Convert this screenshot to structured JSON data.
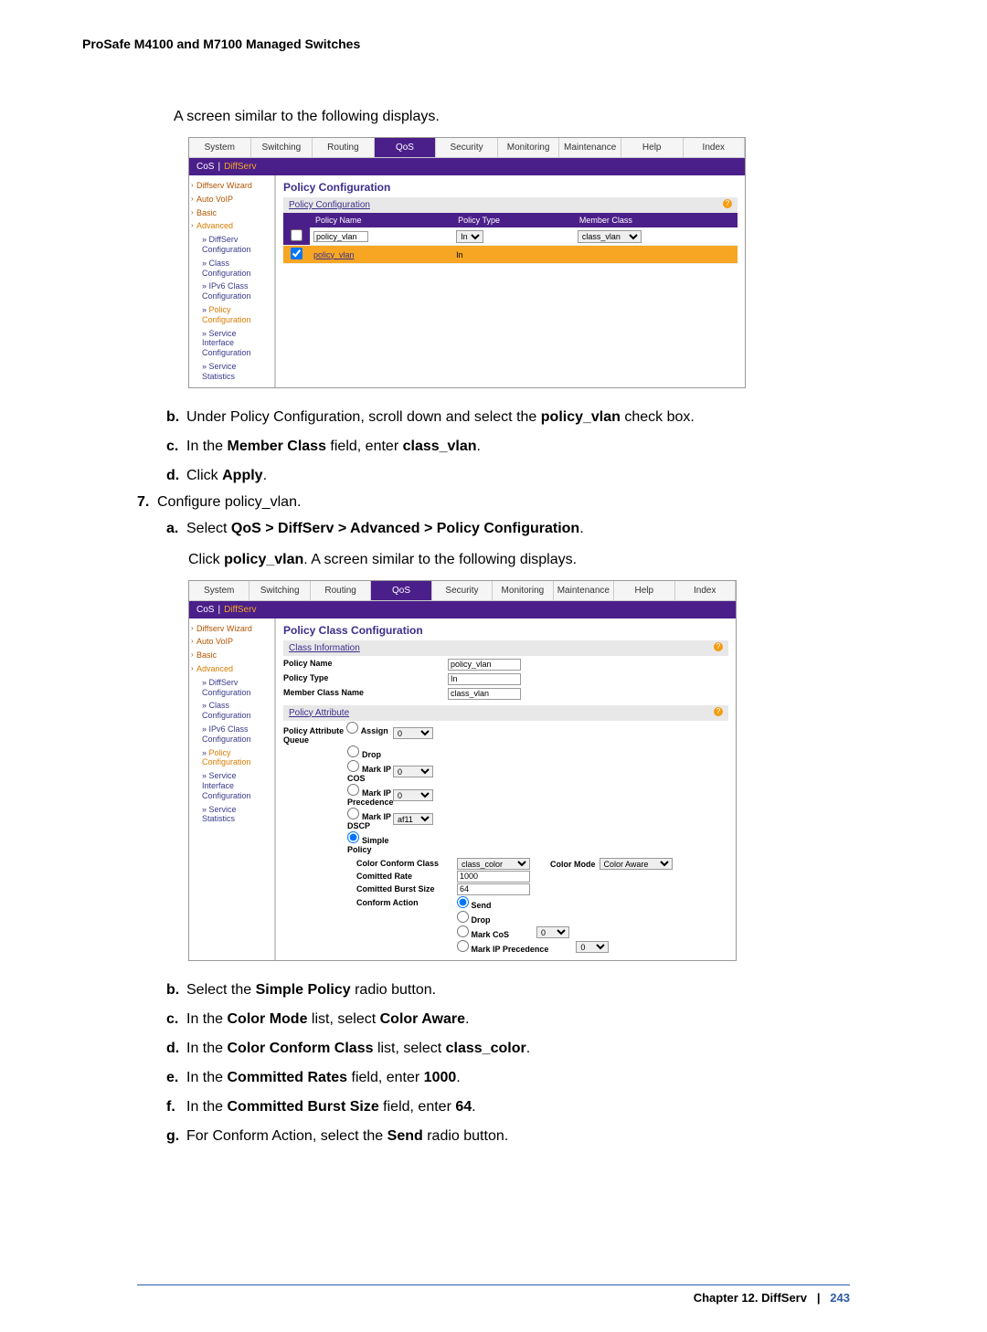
{
  "header": {
    "title": "ProSafe M4100 and M7100 Managed Switches"
  },
  "intro1": "A screen similar to the following displays.",
  "shot1": {
    "tabs": [
      "System",
      "Switching",
      "Routing",
      "QoS",
      "Security",
      "Monitoring",
      "Maintenance",
      "Help",
      "Index"
    ],
    "active_tab": "QoS",
    "subnav": [
      "CoS",
      "|",
      "DiffServ"
    ],
    "subnav_sel": "DiffServ",
    "sidebar": [
      {
        "t": "Diffserv Wizard"
      },
      {
        "t": "Auto VoIP"
      },
      {
        "t": "Basic"
      },
      {
        "t": "Advanced",
        "sel": true
      },
      {
        "t": "DiffServ Configuration",
        "sub": true
      },
      {
        "t": "Class Configuration",
        "sub": true
      },
      {
        "t": "IPv6 Class Configuration",
        "sub": true
      },
      {
        "t": "Policy Configuration",
        "sub": true,
        "sel": true
      },
      {
        "t": "Service Interface Configuration",
        "sub": true
      },
      {
        "t": "Service Statistics",
        "sub": true
      }
    ],
    "pane_title": "Policy Configuration",
    "section_label": "Policy Configuration",
    "cols": [
      "",
      "Policy Name",
      "Policy Type",
      "Member Class"
    ],
    "row_edit": {
      "cb": false,
      "name": "policy_vlan",
      "type": "In",
      "member": "class_vlan"
    },
    "row_sel": {
      "cb": true,
      "name": "policy_vlan",
      "type_text": "In"
    }
  },
  "steps1": [
    {
      "l": "b.",
      "t_pre": "Under Policy Configuration, scroll down and select the ",
      "bold": "policy_vlan",
      "t_post": " check box."
    },
    {
      "l": "c.",
      "t_pre": "In the ",
      "bold": "Member Class",
      "t_mid": " field, enter ",
      "bold2": "class_vlan",
      "t_post": "."
    },
    {
      "l": "d.",
      "t_pre": "Click ",
      "bold": "Apply",
      "t_post": "."
    }
  ],
  "step7": {
    "num": "7.",
    "text": "Configure policy_vlan."
  },
  "steps2a": {
    "l": "a.",
    "t_pre": "Select ",
    "bold": "QoS > DiffServ > Advanced > Policy Configuration",
    "t_post": "."
  },
  "click_text_pre": "Click ",
  "click_bold": "policy_vlan",
  "click_text_post": ". A screen similar to the following displays.",
  "shot2": {
    "tabs": [
      "System",
      "Switching",
      "Routing",
      "QoS",
      "Security",
      "Monitoring",
      "Maintenance",
      "Help",
      "Index"
    ],
    "active_tab": "QoS",
    "subnav": [
      "CoS",
      "|",
      "DiffServ"
    ],
    "subnav_sel": "DiffServ",
    "pane_title": "Policy Class Configuration",
    "section1": "Class Information",
    "info": [
      {
        "lab": "Policy Name",
        "val": "policy_vlan"
      },
      {
        "lab": "Policy Type",
        "val": "In"
      },
      {
        "lab": "Member Class Name",
        "val": "class_vlan"
      }
    ],
    "section2": "Policy Attribute",
    "attr_label": "Policy Attribute",
    "attrs": [
      {
        "r": "Assign Queue",
        "sel": "0"
      },
      {
        "r": "Drop"
      },
      {
        "r": "Mark IP COS",
        "sel": "0"
      },
      {
        "r": "Mark IP Precedence",
        "sel": "0"
      },
      {
        "r": "Mark IP DSCP",
        "sel": "af11"
      },
      {
        "r": "Simple Policy",
        "checked": true
      }
    ],
    "simple": {
      "color_conform_label": "Color Conform Class",
      "color_conform": "class_color",
      "color_mode_label": "Color Mode",
      "color_mode": "Color Aware",
      "committed_rate_label": "Comitted Rate",
      "committed_rate": "1000",
      "burst_label": "Comitted Burst Size",
      "burst": "64",
      "conform_label": "Conform Action",
      "conform_actions": [
        {
          "r": "Send",
          "checked": true
        },
        {
          "r": "Drop"
        },
        {
          "r": "Mark CoS",
          "sel": "0"
        },
        {
          "r": "Mark IP Precedence",
          "sel": "0"
        }
      ]
    }
  },
  "steps3": [
    {
      "l": "b.",
      "t_pre": "Select the ",
      "bold": "Simple Policy",
      "t_post": " radio button."
    },
    {
      "l": "c.",
      "t_pre": "In the ",
      "bold": "Color Mode",
      "t_mid": " list, select ",
      "bold2": "Color Aware",
      "t_post": "."
    },
    {
      "l": "d.",
      "t_pre": "In the ",
      "bold": "Color Conform Class",
      "t_mid": " list, select ",
      "bold2": "class_color",
      "t_post": "."
    },
    {
      "l": "e.",
      "t_pre": "In the ",
      "bold": "Committed Rates",
      "t_mid": " field, enter ",
      "bold2": "1000",
      "t_post": "."
    },
    {
      "l": "f.",
      "t_pre": "In the ",
      "bold": "Committed Burst Size",
      "t_mid": " field, enter ",
      "bold2": "64",
      "t_post": "."
    },
    {
      "l": "g.",
      "t_pre": "For Conform Action, select the ",
      "bold": "Send",
      "t_post": " radio button."
    }
  ],
  "footer": {
    "chapter": "Chapter 12.  DiffServ",
    "sep": "|",
    "page": "243"
  }
}
